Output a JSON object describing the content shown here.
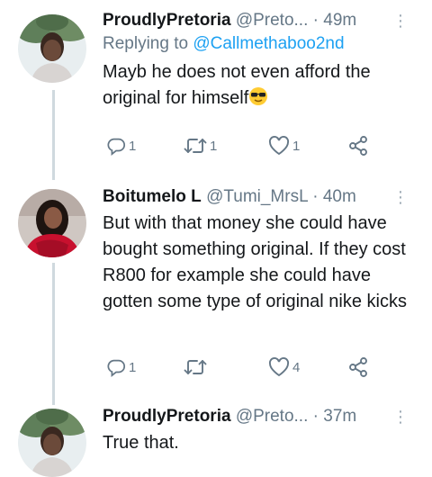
{
  "tweets": [
    {
      "name": "ProudlyPretoria",
      "handle": "@Preto...",
      "dot": "·",
      "time": "49m",
      "more": "⋮",
      "reply_prefix": "Replying to ",
      "reply_mention": "@Callmethaboo2nd",
      "text": "Mayb he does not even afford the original for himself",
      "emoji": "sunglasses-face",
      "reply_count": "1",
      "retweet_count": "1",
      "like_count": "1"
    },
    {
      "name": "Boitumelo L",
      "handle": "@Tumi_MrsL",
      "dot": "·",
      "time": "40m",
      "more": "⋮",
      "text": "But with that money she could have bought something original. If they cost R800 for example she could have gotten some type of original nike kicks",
      "reply_count": "1",
      "retweet_count": "",
      "like_count": "4"
    },
    {
      "name": "ProudlyPretoria",
      "handle": "@Preto...",
      "dot": "·",
      "time": "37m",
      "more": "⋮",
      "text": "True that."
    }
  ],
  "icons": {
    "reply": "reply-icon",
    "retweet": "retweet-icon",
    "like": "heart-icon",
    "share": "share-icon"
  },
  "colors": {
    "text": "#14171a",
    "secondary": "#657786",
    "mention": "#1da1f2",
    "thread_line": "#cfd9de"
  }
}
